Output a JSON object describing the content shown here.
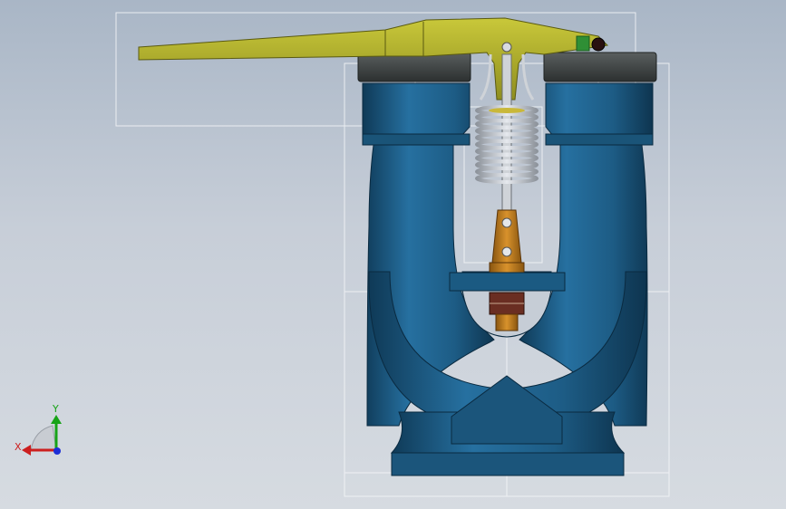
{
  "viewport": {
    "background_top": "#a9b6c6",
    "background_bottom": "#d6dbe1"
  },
  "model": {
    "body_color": "#1f5f86",
    "body_shade": "#12405e",
    "lever_color": "#b7b62a",
    "lever_shade": "#8d8c1c",
    "cap_color": "#3c4040",
    "spring_color": "#b9bec6",
    "link_color": "#c07a1c",
    "seat_color": "#5a2a20",
    "bounding_box_color": "#f2f4f6"
  },
  "triad": {
    "x_label": "X",
    "y_label": "Y",
    "x_color": "#cc1f1f",
    "y_color": "#17a317",
    "z_color": "#1c2ed6"
  }
}
